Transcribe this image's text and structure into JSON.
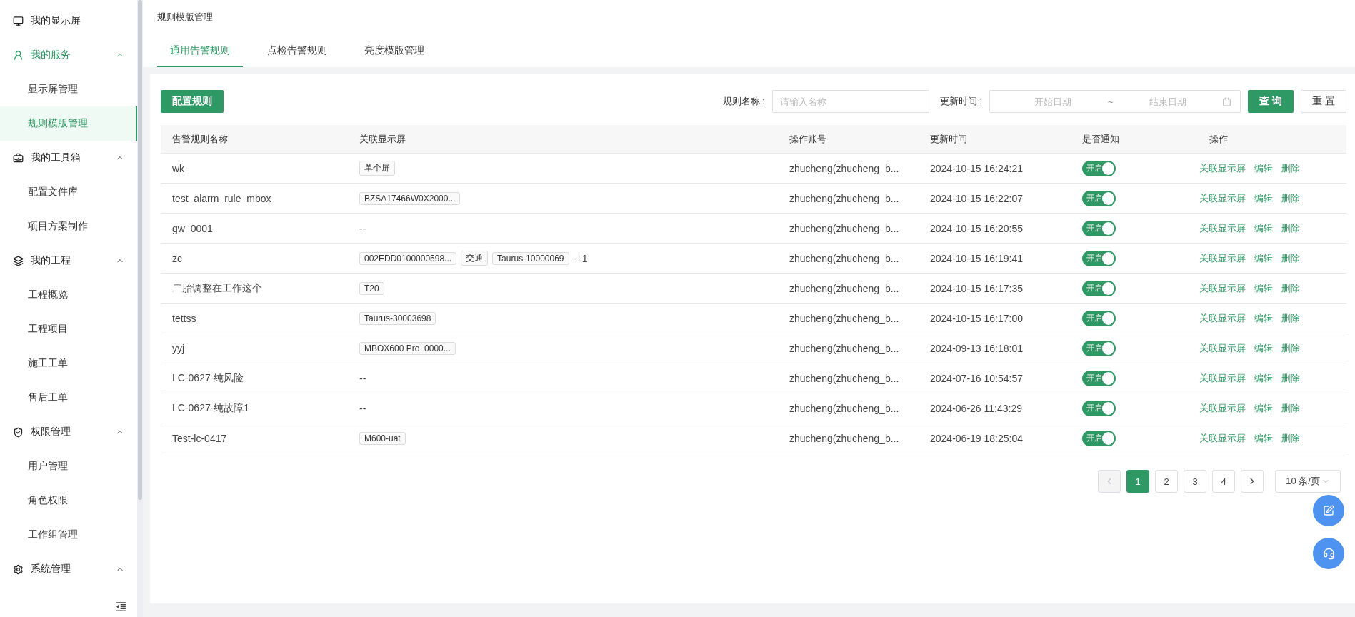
{
  "sidebar": {
    "groups": [
      {
        "label": "我的显示屏",
        "kind": "link",
        "active": false
      },
      {
        "label": "我的服务",
        "kind": "group",
        "active": true,
        "expanded": true,
        "children": [
          {
            "label": "显示屏管理",
            "selected": false
          },
          {
            "label": "规则模版管理",
            "selected": true
          }
        ]
      },
      {
        "label": "我的工具箱",
        "kind": "group",
        "active": false,
        "expanded": true,
        "children": [
          {
            "label": "配置文件库",
            "selected": false
          },
          {
            "label": "项目方案制作",
            "selected": false
          }
        ]
      },
      {
        "label": "我的工程",
        "kind": "group",
        "active": false,
        "expanded": true,
        "children": [
          {
            "label": "工程概览",
            "selected": false
          },
          {
            "label": "工程项目",
            "selected": false
          },
          {
            "label": "施工工单",
            "selected": false
          },
          {
            "label": "售后工单",
            "selected": false
          }
        ]
      },
      {
        "label": "权限管理",
        "kind": "group",
        "active": false,
        "expanded": true,
        "children": [
          {
            "label": "用户管理",
            "selected": false
          },
          {
            "label": "角色权限",
            "selected": false
          },
          {
            "label": "工作组管理",
            "selected": false
          }
        ]
      },
      {
        "label": "系统管理",
        "kind": "group",
        "active": false,
        "expanded": true
      }
    ]
  },
  "page_title": "规则模版管理",
  "tabs": [
    {
      "label": "通用告警规则",
      "selected": true
    },
    {
      "label": "点检告警规则",
      "selected": false
    },
    {
      "label": "亮度模版管理",
      "selected": false
    }
  ],
  "toolbar": {
    "config_button": "配置规则",
    "name_label": "规则名称 :",
    "name_placeholder": "请输入名称",
    "time_label": "更新时间 :",
    "start_placeholder": "开始日期",
    "range_separator": "~",
    "end_placeholder": "结束日期",
    "query_button": "查 询",
    "reset_button": "重 置"
  },
  "table": {
    "columns": [
      "告警规则名称",
      "关联显示屏",
      "操作账号",
      "更新时间",
      "是否通知",
      "操作"
    ],
    "rows": [
      {
        "name": "wk",
        "screens": [
          "单个屏"
        ],
        "account": "zhucheng(zhucheng_b...",
        "updated": "2024-10-15 16:24:21",
        "notify": {
          "on": true,
          "label": "开启"
        },
        "actions": [
          "关联显示屏",
          "编辑",
          "删除"
        ]
      },
      {
        "name": "test_alarm_rule_mbox",
        "screens": [
          "BZSA17466W0X2000..."
        ],
        "account": "zhucheng(zhucheng_b...",
        "updated": "2024-10-15 16:22:07",
        "notify": {
          "on": true,
          "label": "开启"
        },
        "actions": [
          "关联显示屏",
          "编辑",
          "删除"
        ]
      },
      {
        "name": "gw_0001",
        "screens_empty": "--",
        "account": "zhucheng(zhucheng_b...",
        "updated": "2024-10-15 16:20:55",
        "notify": {
          "on": true,
          "label": "开启"
        },
        "actions": [
          "关联显示屏",
          "编辑",
          "删除"
        ]
      },
      {
        "name": "zc",
        "screens": [
          "002EDD0100000598...",
          "交通",
          "Taurus-10000069"
        ],
        "more": "+1",
        "account": "zhucheng(zhucheng_b...",
        "updated": "2024-10-15 16:19:41",
        "notify": {
          "on": true,
          "label": "开启"
        },
        "actions": [
          "关联显示屏",
          "编辑",
          "删除"
        ]
      },
      {
        "name": "二胎调整在工作这个",
        "screens": [
          "T20"
        ],
        "account": "zhucheng(zhucheng_b...",
        "updated": "2024-10-15 16:17:35",
        "notify": {
          "on": true,
          "label": "开启"
        },
        "actions": [
          "关联显示屏",
          "编辑",
          "删除"
        ]
      },
      {
        "name": "tettss",
        "screens": [
          "Taurus-30003698"
        ],
        "account": "zhucheng(zhucheng_b...",
        "updated": "2024-10-15 16:17:00",
        "notify": {
          "on": true,
          "label": "开启"
        },
        "actions": [
          "关联显示屏",
          "编辑",
          "删除"
        ]
      },
      {
        "name": "yyj",
        "screens": [
          "MBOX600 Pro_0000..."
        ],
        "account": "zhucheng(zhucheng_b...",
        "updated": "2024-09-13 16:18:01",
        "notify": {
          "on": true,
          "label": "开启"
        },
        "actions": [
          "关联显示屏",
          "编辑",
          "删除"
        ]
      },
      {
        "name": "LC-0627-纯风险",
        "screens_empty": "--",
        "account": "zhucheng(zhucheng_b...",
        "updated": "2024-07-16 10:54:57",
        "notify": {
          "on": true,
          "label": "开启"
        },
        "actions": [
          "关联显示屏",
          "编辑",
          "删除"
        ]
      },
      {
        "name": "LC-0627-纯故障1",
        "screens_empty": "--",
        "account": "zhucheng(zhucheng_b...",
        "updated": "2024-06-26 11:43:29",
        "notify": {
          "on": true,
          "label": "开启"
        },
        "actions": [
          "关联显示屏",
          "编辑",
          "删除"
        ]
      },
      {
        "name": "Test-lc-0417",
        "screens": [
          "M600-uat"
        ],
        "account": "zhucheng(zhucheng_b...",
        "updated": "2024-06-19 18:25:04",
        "notify": {
          "on": true,
          "label": "开启"
        },
        "actions": [
          "关联显示屏",
          "编辑",
          "删除"
        ]
      }
    ]
  },
  "pagination": {
    "prev_disabled": true,
    "next_disabled": false,
    "pages": [
      {
        "label": "1",
        "selected": true
      },
      {
        "label": "2",
        "selected": false
      },
      {
        "label": "3",
        "selected": false
      },
      {
        "label": "4",
        "selected": false
      }
    ],
    "page_size": "10 条/页"
  }
}
